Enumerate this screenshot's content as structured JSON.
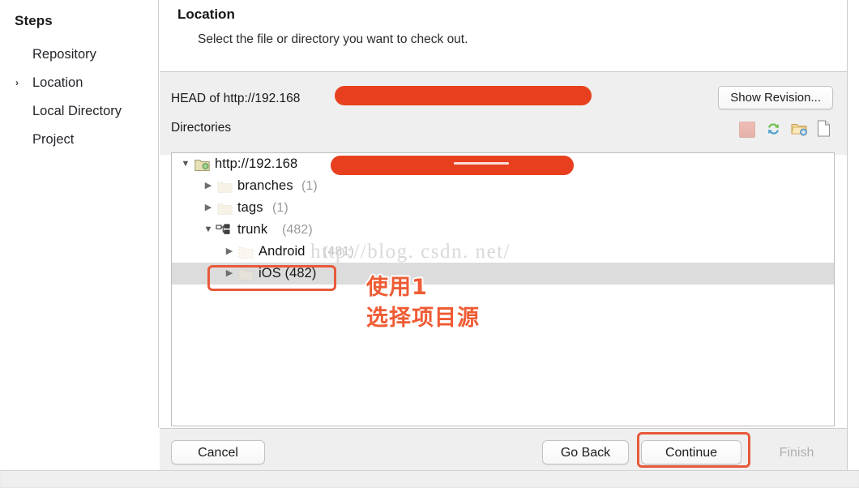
{
  "sidebar": {
    "title": "Steps",
    "items": [
      {
        "label": "Repository",
        "active": false
      },
      {
        "label": "Location",
        "active": true
      },
      {
        "label": "Local Directory",
        "active": false
      },
      {
        "label": "Project",
        "active": false
      }
    ],
    "active_marker": "›"
  },
  "pane": {
    "title": "Location",
    "subtitle": "Select the file or directory you want to check out."
  },
  "head": {
    "label": "HEAD of http://192.168",
    "redacted": true,
    "show_revision_button": "Show Revision..."
  },
  "directories": {
    "label": "Directories",
    "toolbar": [
      {
        "name": "delete-icon",
        "title": "Delete"
      },
      {
        "name": "refresh-icon",
        "title": "Refresh"
      },
      {
        "name": "new-folder-icon",
        "title": "New Folder"
      },
      {
        "name": "new-file-icon",
        "title": "New File"
      }
    ]
  },
  "tree": {
    "nodes": [
      {
        "label": "http://192.168",
        "count": "",
        "depth": 0,
        "twisty": "open",
        "icon": "repository-folder-icon",
        "selected": false,
        "redacted": true
      },
      {
        "label": "branches",
        "count": "(1)",
        "depth": 1,
        "twisty": "closed",
        "icon": "folder-icon",
        "selected": false,
        "redacted": false
      },
      {
        "label": "tags",
        "count": "(1)",
        "depth": 1,
        "twisty": "closed",
        "icon": "folder-icon",
        "selected": false,
        "redacted": false
      },
      {
        "label": "trunk",
        "count": "(482)",
        "depth": 1,
        "twisty": "open",
        "icon": "branch-icon",
        "selected": false,
        "redacted": false
      },
      {
        "label": "Android",
        "count": "(481)",
        "depth": 2,
        "twisty": "closed",
        "icon": "folder-icon",
        "selected": false,
        "redacted": false
      },
      {
        "label": "iOS (482)",
        "count": "",
        "depth": 2,
        "twisty": "closed",
        "icon": "folder-icon",
        "selected": true,
        "redacted": false
      }
    ]
  },
  "annotations": {
    "step_number_text": "使用1",
    "instruction_text": "选择项目源",
    "highlight_color": "#e8593a",
    "text_color": "#ef5b33"
  },
  "watermark": {
    "text": "http://blog. csdn. net/"
  },
  "footer": {
    "cancel": "Cancel",
    "go_back": "Go Back",
    "continue": "Continue",
    "finish": "Finish",
    "finish_disabled": true
  },
  "colors": {
    "redaction": "#e8401f",
    "selection_row": "#dcdcdc",
    "chrome": "#efefef"
  }
}
